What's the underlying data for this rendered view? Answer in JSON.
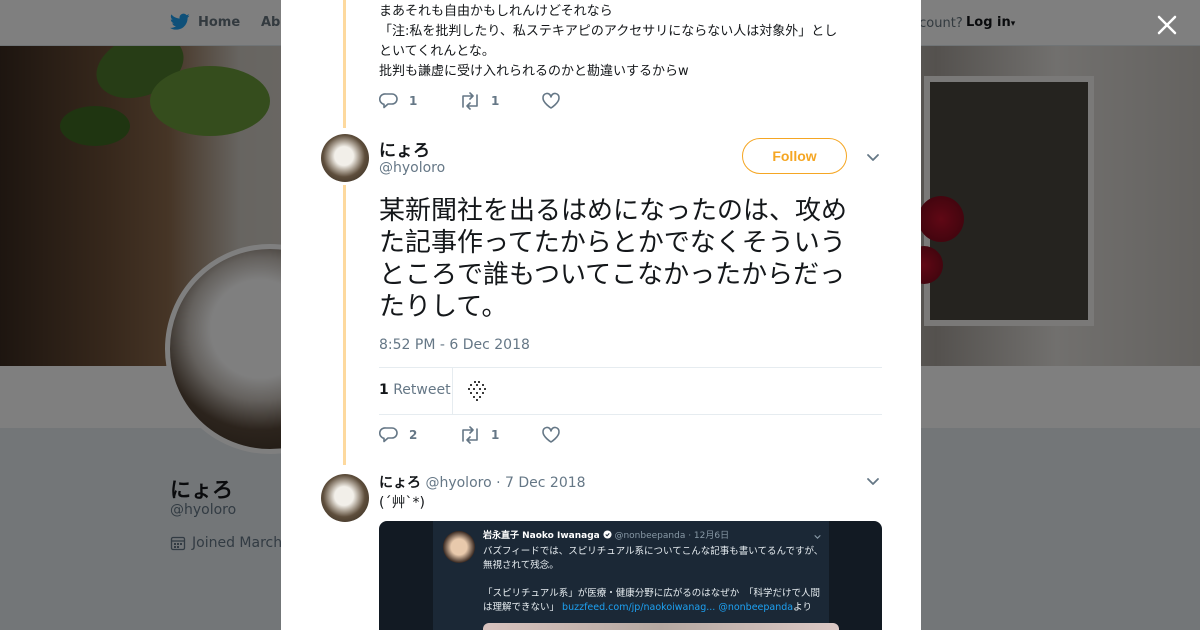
{
  "nav": {
    "home_label": "Home",
    "about_label": "Abo",
    "account_prompt": "ccount?",
    "login_label": "Log in"
  },
  "profile": {
    "name": "にょろ",
    "handle": "@hyoloro",
    "joined": "Joined March"
  },
  "previous_tweet": {
    "lines": [
      "まあそれも自由かもしれんけどそれなら",
      "「注:私を批判したり、私ステキアピのアクセサリにならない人は対象外」とし",
      "といてくれんとな。",
      "批判も謙虚に受け入れられるのかと勘違いするからw"
    ],
    "replies": "1",
    "retweets": "1"
  },
  "main_tweet": {
    "name": "にょろ",
    "handle": "@hyoloro",
    "follow_label": "Follow",
    "text": "某新聞社を出るはめになったのは、攻めた記事作ってたからとかでなくそういうところで誰もついてこなかったからだったりして。",
    "timestamp": "8:52 PM - 6 Dec 2018",
    "retweet_count": "1",
    "retweet_label": "Retweet",
    "replies": "2",
    "retweets": "1"
  },
  "reply_tweet": {
    "name": "にょろ",
    "handle": "@hyoloro",
    "separator": "·",
    "date": "7 Dec 2018",
    "text": "(´艸`*)",
    "embed": {
      "author": "岩永直子 Naoko Iwanaga",
      "handle": "@nonbeepanda · 12月6日",
      "line1": "バズフィードでは、スピリチュアル系についてこんな記事も書いてるんですが、",
      "line2": "無視されて残念。",
      "line3": "「スピリチュアル系」が医療・健康分野に広がるのはなぜか　「科学だけで人間",
      "line4_text": "は理解できない」",
      "line4_link": "buzzfeed.com/jp/naokoiwanag... @nonbeepanda",
      "line4_suffix": "より"
    }
  },
  "colors": {
    "accent": "#f5a623",
    "thread_line": "#fdd99e",
    "text": "#14171a",
    "muted": "#657786",
    "twitter_blue": "#1da1f2"
  },
  "icons": [
    "twitter-bird-icon",
    "close-icon",
    "reply-icon",
    "retweet-icon",
    "like-icon",
    "chevron-down-icon",
    "calendar-icon",
    "verified-icon"
  ]
}
